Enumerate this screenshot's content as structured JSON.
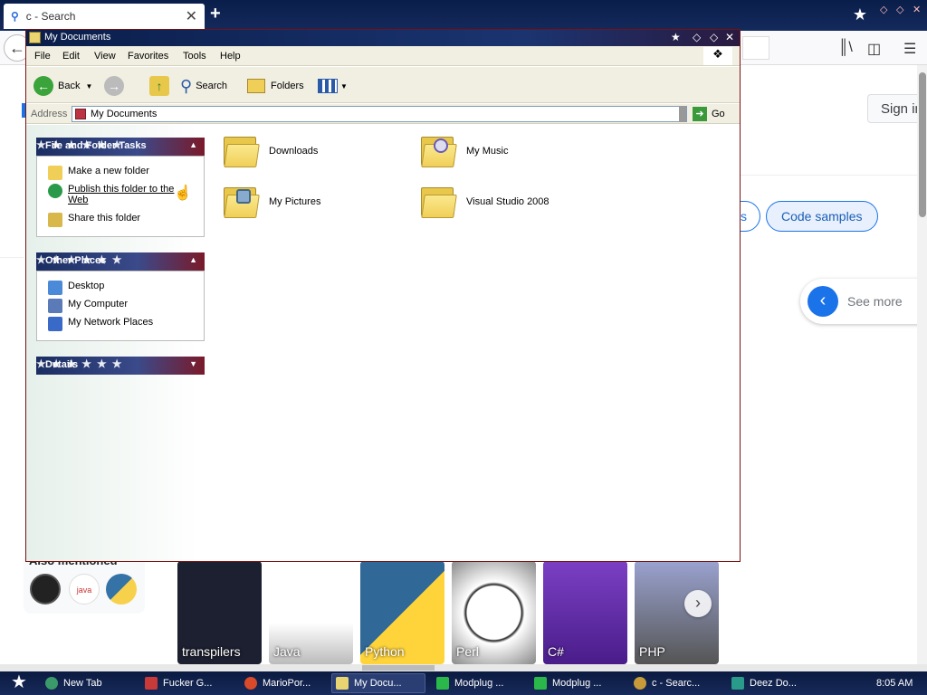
{
  "browser": {
    "tab_title": "c - Search",
    "new_tab_symbol": "+",
    "sign_in": "Sign in",
    "pill_partial": "s",
    "pill_code_samples": "Code samples",
    "see_more": "See more",
    "also_mentioned": "Also mentioned",
    "carousel": [
      {
        "label": "transpilers",
        "color": "#1c2030"
      },
      {
        "label": "Java",
        "color": "#f4f4f4"
      },
      {
        "label": "Python",
        "color": "#2f6ea5"
      },
      {
        "label": "Perl",
        "color": "#ffffff"
      },
      {
        "label": "C#",
        "color": "#6a2fb0"
      },
      {
        "label": "PHP",
        "color": "#8892bf"
      }
    ]
  },
  "explorer": {
    "title": "My Documents",
    "menu": [
      "File",
      "Edit",
      "View",
      "Favorites",
      "Tools",
      "Help"
    ],
    "toolbar": {
      "back": "Back",
      "search": "Search",
      "folders": "Folders"
    },
    "address_label": "Address",
    "address_value": "My Documents",
    "go": "Go",
    "panels": {
      "file_tasks": {
        "title": "File and Folder Tasks",
        "items": [
          "Make a new folder",
          "Publish this folder to the Web",
          "Share this folder"
        ]
      },
      "other_places": {
        "title": "Other Places",
        "items": [
          "Desktop",
          "My Computer",
          "My Network Places"
        ]
      },
      "details": {
        "title": "Details"
      }
    },
    "folders": [
      "Downloads",
      "My Music",
      "My Pictures",
      "Visual Studio 2008"
    ]
  },
  "taskbar": {
    "items": [
      "New Tab",
      "Fucker G...",
      "MarioPor...",
      "My Docu...",
      "Modplug ...",
      "Modplug ...",
      "c - Searc...",
      "Deez Do..."
    ],
    "clock": "8:05 AM"
  },
  "colors": {
    "titlebar": "#0a1e4a",
    "accent_blue": "#1a73e8",
    "xp_chrome": "#f1efe2",
    "border_red": "#7a1010"
  }
}
